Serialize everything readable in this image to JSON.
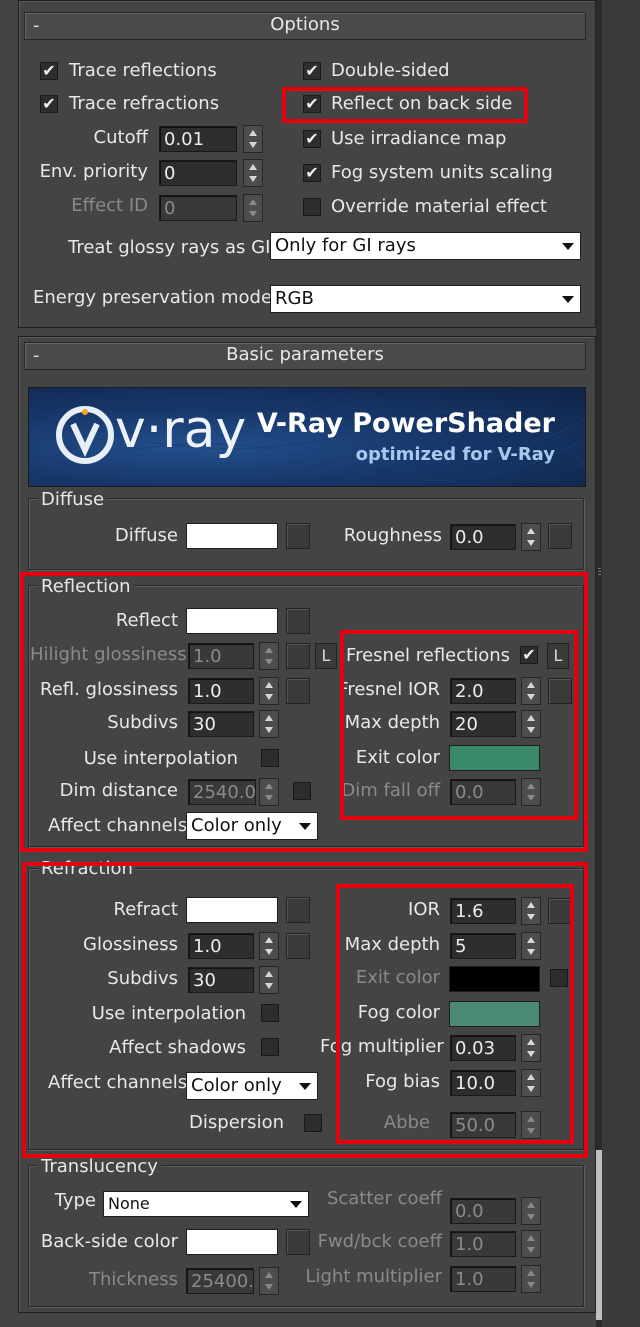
{
  "options": {
    "title": "Options",
    "collapse": "-",
    "trace_reflections": "Trace reflections",
    "trace_refractions": "Trace refractions",
    "cutoff_label": "Cutoff",
    "cutoff_value": "0.01",
    "env_priority_label": "Env. priority",
    "env_priority_value": "0",
    "effect_id_label": "Effect ID",
    "effect_id_value": "0",
    "double_sided": "Double-sided",
    "reflect_on_back_side": "Reflect on back side",
    "use_irradiance_map": "Use irradiance map",
    "fog_units_scaling": "Fog system units scaling",
    "override_material_effect": "Override material effect",
    "treat_glossy_label": "Treat glossy rays as GI",
    "treat_glossy_value": "Only for GI rays",
    "energy_label": "Energy preservation mode:",
    "energy_value": "RGB",
    "check_mark": "✔"
  },
  "basic": {
    "title": "Basic parameters",
    "collapse": "-",
    "logo_text": "v·ray",
    "banner_title": "V-Ray PowerShader",
    "banner_subtitle": "optimized for V-Ray"
  },
  "diffuse": {
    "group_title": "Diffuse",
    "diffuse_label": "Diffuse",
    "roughness_label": "Roughness",
    "roughness_value": "0.0",
    "diffuse_color": "#ffffff"
  },
  "reflection": {
    "group_title": "Reflection",
    "reflect_label": "Reflect",
    "reflect_color": "#ffffff",
    "hilight_label": "Hilight glossiness",
    "hilight_value": "1.0",
    "l_button": "L",
    "refl_gloss_label": "Refl. glossiness",
    "refl_gloss_value": "1.0",
    "subdivs_label": "Subdivs",
    "subdivs_value": "30",
    "use_interp_label": "Use interpolation",
    "dim_distance_label": "Dim distance",
    "dim_distance_value": "2540.0",
    "affect_channels_label": "Affect channels",
    "affect_channels_value": "Color only",
    "fresnel_label": "Fresnel reflections",
    "fresnel_ior_label": "Fresnel IOR",
    "fresnel_ior_value": "2.0",
    "max_depth_label": "Max depth",
    "max_depth_value": "20",
    "exit_color_label": "Exit color",
    "exit_color": "#3a8a6a",
    "dim_falloff_label": "Dim fall off",
    "dim_falloff_value": "0.0"
  },
  "refraction": {
    "group_title": "Refraction",
    "refract_label": "Refract",
    "refract_color": "#ffffff",
    "glossiness_label": "Glossiness",
    "glossiness_value": "1.0",
    "subdivs_label": "Subdivs",
    "subdivs_value": "30",
    "use_interp_label": "Use interpolation",
    "affect_shadows_label": "Affect shadows",
    "affect_channels_label": "Affect channels",
    "affect_channels_value": "Color only",
    "dispersion_label": "Dispersion",
    "ior_label": "IOR",
    "ior_value": "1.6",
    "max_depth_label": "Max depth",
    "max_depth_value": "5",
    "exit_color_label": "Exit color",
    "exit_color": "#000000",
    "fog_color_label": "Fog color",
    "fog_color": "#4a8a74",
    "fog_mult_label": "Fog multiplier",
    "fog_mult_value": "0.03",
    "fog_bias_label": "Fog bias",
    "fog_bias_value": "10.0",
    "abbe_label": "Abbe",
    "abbe_value": "50.0"
  },
  "translucency": {
    "group_title": "Translucency",
    "type_label": "Type",
    "type_value": "None",
    "back_side_label": "Back-side color",
    "back_side_color": "#ffffff",
    "thickness_label": "Thickness",
    "thickness_value": "25400.",
    "scatter_label": "Scatter coeff",
    "scatter_value": "0.0",
    "fwd_bck_label": "Fwd/bck coeff",
    "fwd_bck_value": "1.0",
    "light_mult_label": "Light multiplier",
    "light_mult_value": "1.0"
  }
}
